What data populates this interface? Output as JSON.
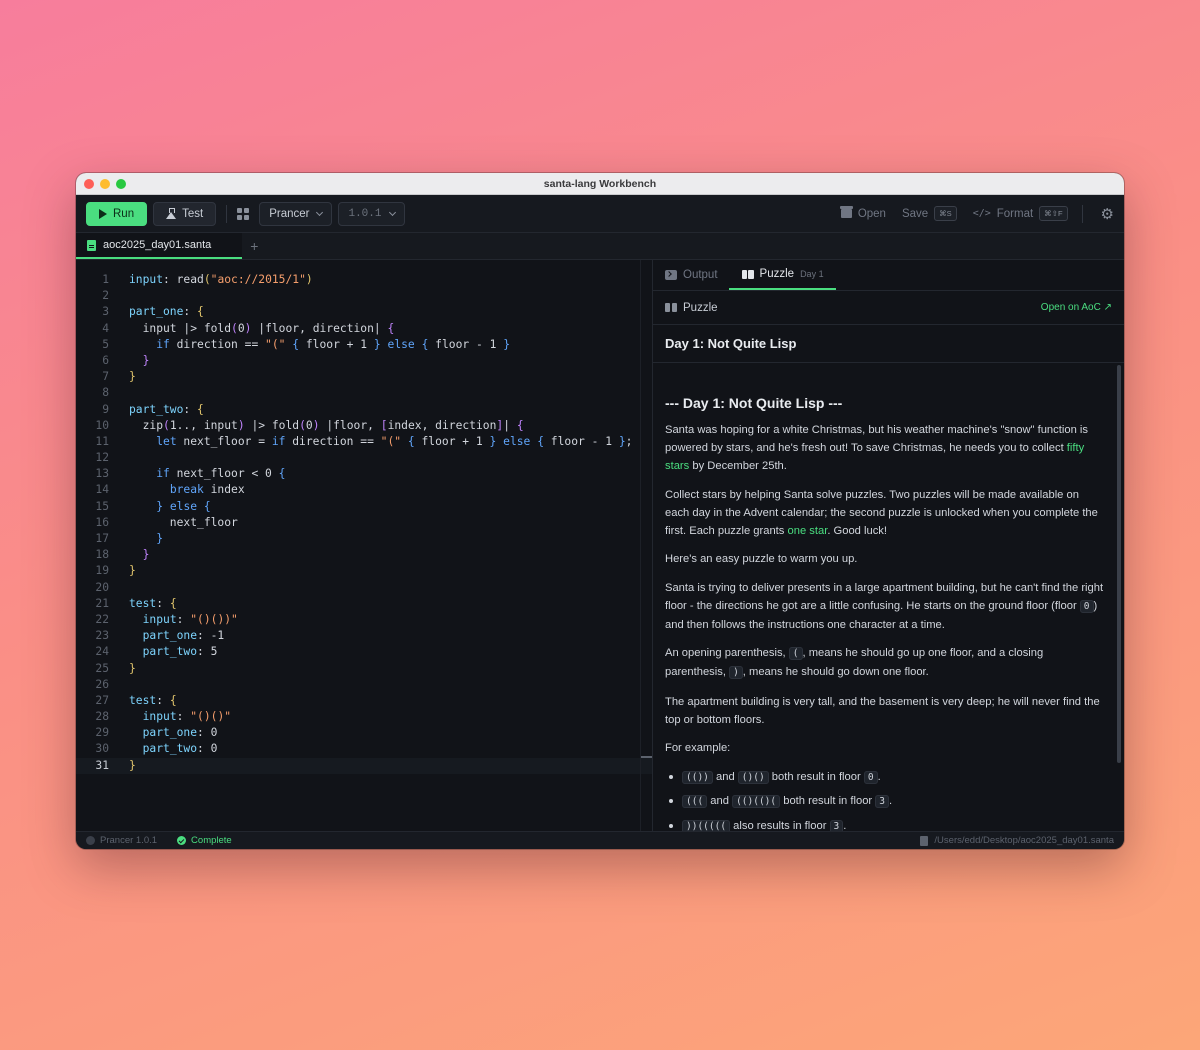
{
  "window": {
    "title": "santa-lang Workbench"
  },
  "toolbar": {
    "run_label": "Run",
    "test_label": "Test",
    "runtime": "Prancer",
    "version": "1.0.1",
    "open_label": "Open",
    "save_label": "Save",
    "save_shortcut": "⌘S",
    "format_label": "Format",
    "format_shortcut": "⌘⇧F"
  },
  "file_tab": {
    "name": "aoc2025_day01.santa",
    "add": "+"
  },
  "editor": {
    "lines": [
      [
        [
          "input",
          "#7dd3fc"
        ],
        [
          ": ",
          "#d2d6dd"
        ],
        [
          "read",
          "#d2d6dd"
        ],
        [
          "(",
          "#e0c46c"
        ],
        [
          "\"aoc://2015/1\"",
          "#f59e6c"
        ],
        [
          ")",
          "#e0c46c"
        ]
      ],
      [],
      [
        [
          "part_one",
          "#7dd3fc"
        ],
        [
          ": ",
          "#d2d6dd"
        ],
        [
          "{",
          "#e0c46c"
        ]
      ],
      [
        [
          "  input |> ",
          "#d2d6dd"
        ],
        [
          "fold",
          "#d2d6dd"
        ],
        [
          "(",
          "#c084fc"
        ],
        [
          "0",
          "#d2d6dd"
        ],
        [
          ") ",
          "#c084fc"
        ],
        [
          "|floor, direction| ",
          "#d2d6dd"
        ],
        [
          "{",
          "#c084fc"
        ]
      ],
      [
        [
          "    ",
          "#d2d6dd"
        ],
        [
          "if",
          "#60a5fa"
        ],
        [
          " direction == ",
          "#d2d6dd"
        ],
        [
          "\"(\"",
          "#f59e6c"
        ],
        [
          " ",
          "#d2d6dd"
        ],
        [
          "{",
          "#60a5fa"
        ],
        [
          " floor + 1 ",
          "#d2d6dd"
        ],
        [
          "}",
          "#60a5fa"
        ],
        [
          " ",
          "#d2d6dd"
        ],
        [
          "else",
          "#60a5fa"
        ],
        [
          " ",
          "#d2d6dd"
        ],
        [
          "{",
          "#60a5fa"
        ],
        [
          " floor - 1 ",
          "#d2d6dd"
        ],
        [
          "}",
          "#60a5fa"
        ]
      ],
      [
        [
          "  ",
          "#d2d6dd"
        ],
        [
          "}",
          "#c084fc"
        ]
      ],
      [
        [
          "}",
          "#e0c46c"
        ]
      ],
      [],
      [
        [
          "part_two",
          "#7dd3fc"
        ],
        [
          ": ",
          "#d2d6dd"
        ],
        [
          "{",
          "#e0c46c"
        ]
      ],
      [
        [
          "  zip",
          "#d2d6dd"
        ],
        [
          "(",
          "#c084fc"
        ],
        [
          "1.., input",
          "#d2d6dd"
        ],
        [
          ")",
          "#c084fc"
        ],
        [
          " |> ",
          "#d2d6dd"
        ],
        [
          "fold",
          "#d2d6dd"
        ],
        [
          "(",
          "#c084fc"
        ],
        [
          "0",
          "#d2d6dd"
        ],
        [
          ")",
          "#c084fc"
        ],
        [
          " |floor, ",
          "#d2d6dd"
        ],
        [
          "[",
          "#c084fc"
        ],
        [
          "index, direction",
          "#d2d6dd"
        ],
        [
          "]",
          "#c084fc"
        ],
        [
          "| ",
          "#d2d6dd"
        ],
        [
          "{",
          "#c084fc"
        ]
      ],
      [
        [
          "    ",
          "#d2d6dd"
        ],
        [
          "let",
          "#60a5fa"
        ],
        [
          " next_floor = ",
          "#d2d6dd"
        ],
        [
          "if",
          "#60a5fa"
        ],
        [
          " direction == ",
          "#d2d6dd"
        ],
        [
          "\"(\"",
          "#f59e6c"
        ],
        [
          " ",
          "#d2d6dd"
        ],
        [
          "{",
          "#60a5fa"
        ],
        [
          " floor + 1 ",
          "#d2d6dd"
        ],
        [
          "}",
          "#60a5fa"
        ],
        [
          " ",
          "#d2d6dd"
        ],
        [
          "else",
          "#60a5fa"
        ],
        [
          " ",
          "#d2d6dd"
        ],
        [
          "{",
          "#60a5fa"
        ],
        [
          " floor - 1 ",
          "#d2d6dd"
        ],
        [
          "}",
          "#60a5fa"
        ],
        [
          ";",
          "#d2d6dd"
        ]
      ],
      [],
      [
        [
          "    ",
          "#d2d6dd"
        ],
        [
          "if",
          "#60a5fa"
        ],
        [
          " next_floor < 0 ",
          "#d2d6dd"
        ],
        [
          "{",
          "#60a5fa"
        ]
      ],
      [
        [
          "      ",
          "#d2d6dd"
        ],
        [
          "break",
          "#60a5fa"
        ],
        [
          " index",
          "#d2d6dd"
        ]
      ],
      [
        [
          "    ",
          "#d2d6dd"
        ],
        [
          "}",
          "#60a5fa"
        ],
        [
          " ",
          "#d2d6dd"
        ],
        [
          "else",
          "#60a5fa"
        ],
        [
          " ",
          "#d2d6dd"
        ],
        [
          "{",
          "#60a5fa"
        ]
      ],
      [
        [
          "      next_floor",
          "#d2d6dd"
        ]
      ],
      [
        [
          "    ",
          "#d2d6dd"
        ],
        [
          "}",
          "#60a5fa"
        ]
      ],
      [
        [
          "  ",
          "#d2d6dd"
        ],
        [
          "}",
          "#c084fc"
        ]
      ],
      [
        [
          "}",
          "#e0c46c"
        ]
      ],
      [],
      [
        [
          "test",
          "#7dd3fc"
        ],
        [
          ": ",
          "#d2d6dd"
        ],
        [
          "{",
          "#e0c46c"
        ]
      ],
      [
        [
          "  ",
          "#d2d6dd"
        ],
        [
          "input",
          "#7dd3fc"
        ],
        [
          ": ",
          "#d2d6dd"
        ],
        [
          "\"()())\"",
          "#f59e6c"
        ]
      ],
      [
        [
          "  ",
          "#d2d6dd"
        ],
        [
          "part_one",
          "#7dd3fc"
        ],
        [
          ": -1",
          "#d2d6dd"
        ]
      ],
      [
        [
          "  ",
          "#d2d6dd"
        ],
        [
          "part_two",
          "#7dd3fc"
        ],
        [
          ": 5",
          "#d2d6dd"
        ]
      ],
      [
        [
          "}",
          "#e0c46c"
        ]
      ],
      [],
      [
        [
          "test",
          "#7dd3fc"
        ],
        [
          ": ",
          "#d2d6dd"
        ],
        [
          "{",
          "#e0c46c"
        ]
      ],
      [
        [
          "  ",
          "#d2d6dd"
        ],
        [
          "input",
          "#7dd3fc"
        ],
        [
          ": ",
          "#d2d6dd"
        ],
        [
          "\"()()\"",
          "#f59e6c"
        ]
      ],
      [
        [
          "  ",
          "#d2d6dd"
        ],
        [
          "part_one",
          "#7dd3fc"
        ],
        [
          ": 0",
          "#d2d6dd"
        ]
      ],
      [
        [
          "  ",
          "#d2d6dd"
        ],
        [
          "part_two",
          "#7dd3fc"
        ],
        [
          ": 0",
          "#d2d6dd"
        ]
      ],
      [
        [
          "}",
          "#e0c46c"
        ]
      ]
    ],
    "current_line": 31
  },
  "panel": {
    "tabs": {
      "output": "Output",
      "puzzle": "Puzzle",
      "puzzle_day": "Day 1"
    },
    "header_label": "Puzzle",
    "open_on_aoc": "Open on AoC ↗",
    "title": "Day 1: Not Quite Lisp",
    "article": {
      "heading": "--- Day 1: Not Quite Lisp ---",
      "p1a": "Santa was hoping for a white Christmas, but his weather machine's \"snow\" function is powered by stars, and he's fresh out! To save Christmas, he needs you to collect ",
      "p1_link": "fifty stars",
      "p1b": " by December 25th.",
      "p2a": "Collect stars by helping Santa solve puzzles. Two puzzles will be made available on each day in the Advent calendar; the second puzzle is unlocked when you complete the first. Each puzzle grants ",
      "p2_link": "one star",
      "p2b": ". Good luck!",
      "p3": "Here's an easy puzzle to warm you up.",
      "p4a": "Santa is trying to deliver presents in a large apartment building, but he can't find the right floor - the directions he got are a little confusing. He starts on the ground floor (floor ",
      "p4_code": "0",
      "p4b": ") and then follows the instructions one character at a time.",
      "p5a": "An opening parenthesis, ",
      "p5_code1": "(",
      "p5b": ", means he should go up one floor, and a closing parenthesis, ",
      "p5_code2": ")",
      "p5c": ", means he should go down one floor.",
      "p6": "The apartment building is very tall, and the basement is very deep; he will never find the top or bottom floors.",
      "p7": "For example:",
      "ex1_c1": "(())",
      "ex1_and": " and ",
      "ex1_c2": "()()",
      "ex1_t": " both result in floor ",
      "ex1_c3": "0",
      "ex1_end": ".",
      "ex2_c1": "(((",
      "ex2_and": " and ",
      "ex2_c2": "(()(()(",
      "ex2_t": " both result in floor ",
      "ex2_c3": "3",
      "ex2_end": ".",
      "ex3_c1": "))(((((",
      "ex3_t": " also results in floor ",
      "ex3_c2": "3",
      "ex3_end": "."
    }
  },
  "status": {
    "runtime": "Prancer 1.0.1",
    "state": "Complete",
    "path": "/Users/edd/Desktop/aoc2025_day01.santa"
  },
  "colors": {
    "accent": "#4ade80",
    "background": "#111318",
    "keyword": "#60a5fa",
    "property": "#7dd3fc",
    "string": "#f59e6c",
    "bracket_outer": "#e0c46c",
    "bracket_inner": "#c084fc"
  },
  "icons": [
    "play-icon",
    "flask-icon",
    "grid-icon",
    "chevron-down-icon",
    "box-icon",
    "code-icon",
    "gear-icon",
    "file-icon",
    "plus-icon",
    "terminal-icon",
    "book-icon",
    "external-link-icon",
    "check-circle-icon",
    "status-dot-icon",
    "document-icon"
  ]
}
